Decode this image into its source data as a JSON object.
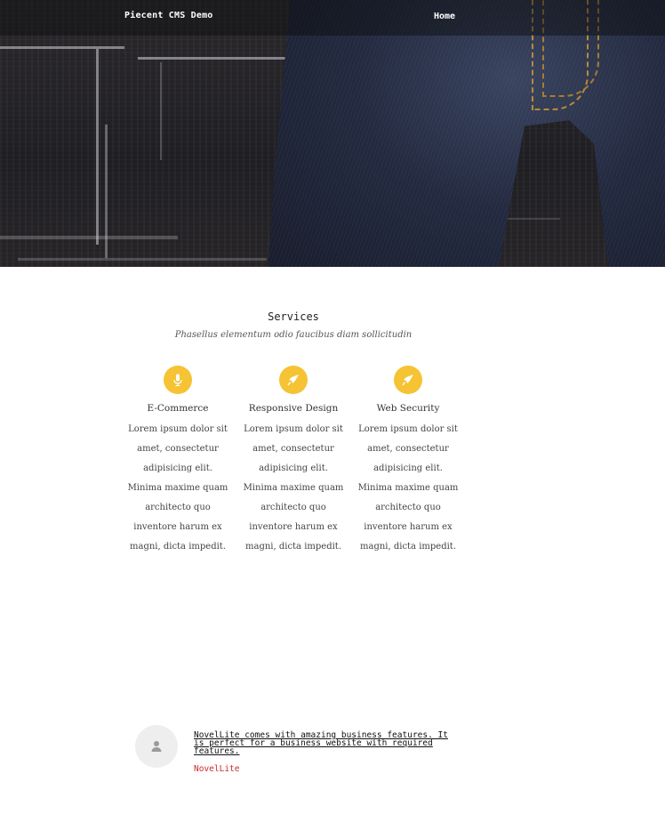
{
  "header": {
    "brand": "Piecent CMS Demo",
    "nav": [
      {
        "label": "Home"
      }
    ]
  },
  "hero": {
    "image": "dark-jeans-chalkboard-photo"
  },
  "services": {
    "title": "Services",
    "subtitle": "Phasellus elementum odio faucibus diam sollicitudin",
    "icon_color": "#f5c333",
    "items": [
      {
        "icon": "microphone-icon",
        "name": "E-Commerce",
        "text": "Lorem ipsum dolor sit amet, consectetur adipisicing elit. Minima maxime quam architecto quo inventore harum ex magni, dicta impedit."
      },
      {
        "icon": "rocket-icon",
        "name": "Responsive Design",
        "text": "Lorem ipsum dolor sit amet, consectetur adipisicing elit. Minima maxime quam architecto quo inventore harum ex magni, dicta impedit."
      },
      {
        "icon": "rocket-icon",
        "name": "Web Security",
        "text": "Lorem ipsum dolor sit amet, consectetur adipisicing elit. Minima maxime quam architecto quo inventore harum ex magni, dicta impedit."
      }
    ]
  },
  "testimonial": {
    "avatar_icon": "user-icon",
    "quote": "NovelLite comes with amazing business features. It is perfect for a business website with required features.",
    "author": "NovelLite",
    "author_color": "#cc2b2b"
  }
}
